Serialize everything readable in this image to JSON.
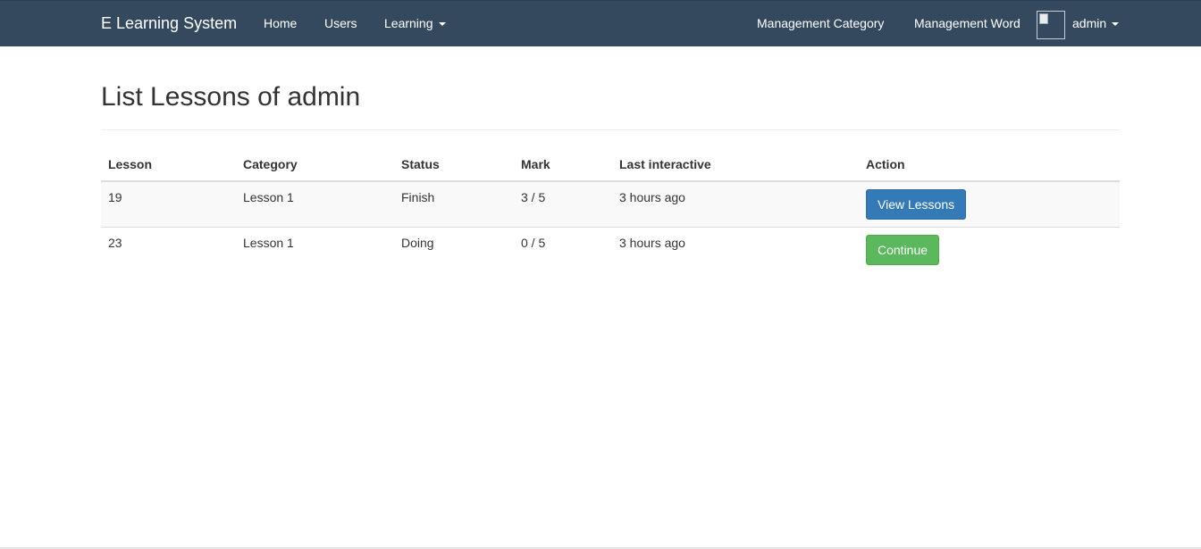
{
  "navbar": {
    "brand": "E Learning System",
    "links": {
      "home": "Home",
      "users": "Users",
      "learning": "Learning",
      "management_category": "Management Category",
      "management_word": "Management Word",
      "user": "admin"
    },
    "colors": {
      "background": "#34495e",
      "text": "#ffffff"
    }
  },
  "page": {
    "title": "List Lessons of admin"
  },
  "table": {
    "headers": [
      "Lesson",
      "Category",
      "Status",
      "Mark",
      "Last interactive",
      "Action"
    ],
    "rows": [
      {
        "lesson": "19",
        "category": "Lesson 1",
        "status": "Finish",
        "mark": "3 / 5",
        "last_interactive": "3 hours ago",
        "action": "View Lessons"
      },
      {
        "lesson": "23",
        "category": "Lesson 1",
        "status": "Doing",
        "mark": "0 / 5",
        "last_interactive": "3 hours ago",
        "action": "Continue"
      }
    ]
  },
  "colors": {
    "primary_button": "#337ab7",
    "success_button": "#5cb85c"
  },
  "icons": {
    "learning_dropdown": "caret-down-icon",
    "user_dropdown": "caret-down-icon",
    "avatar": "broken-image-icon"
  }
}
